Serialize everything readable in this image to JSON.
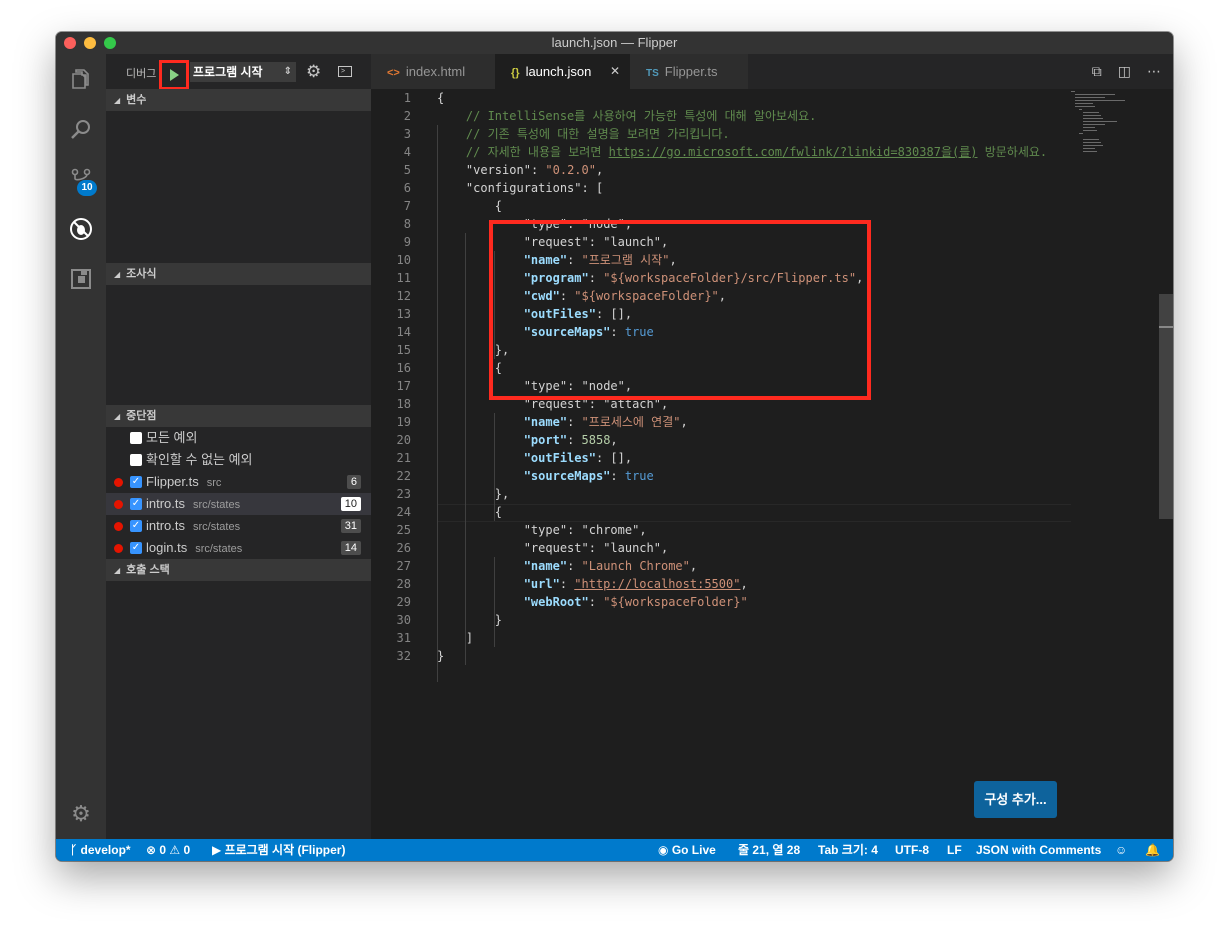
{
  "window": {
    "title": "launch.json — Flipper"
  },
  "activitybar": {
    "scm_badge": "10"
  },
  "debug": {
    "title": "디버그",
    "config_selected": "프로그램 시작",
    "select_arrows": "⇕"
  },
  "sections": {
    "variables": "변수",
    "watch": "조사식",
    "breakpoints": "중단점",
    "callstack": "호출 스택"
  },
  "breakpoints": {
    "all_exceptions": "모든 예외",
    "uncaught_exceptions": "확인할 수 없는 예외",
    "items": [
      {
        "file": "Flipper.ts",
        "path": "src",
        "line": "6"
      },
      {
        "file": "intro.ts",
        "path": "src/states",
        "line": "10"
      },
      {
        "file": "intro.ts",
        "path": "src/states",
        "line": "31"
      },
      {
        "file": "login.ts",
        "path": "src/states",
        "line": "14"
      }
    ]
  },
  "tabs": [
    {
      "icon": "<>",
      "label": "index.html"
    },
    {
      "icon": "{}",
      "label": "launch.json"
    },
    {
      "icon": "TS",
      "label": "Flipper.ts"
    }
  ],
  "tab_colors": {
    "html_icon": "#e37933",
    "json_icon": "#cbcb41",
    "ts_icon": "#519aba"
  },
  "code": {
    "line_numbers": [
      "1",
      "2",
      "3",
      "4",
      "5",
      "6",
      "7",
      "8",
      "9",
      "10",
      "11",
      "12",
      "13",
      "14",
      "15",
      "16",
      "17",
      "18",
      "19",
      "20",
      "21",
      "22",
      "23",
      "24",
      "25",
      "26",
      "27",
      "28",
      "29",
      "30",
      "31",
      "32"
    ],
    "comment1": "// IntelliSense를 사용하여 가능한 특성에 대해 알아보세요.",
    "comment2": "// 기존 특성에 대한 설명을 보려면 가리킵니다.",
    "comment3_pre": "// 자세한 내용을 보려면 ",
    "comment3_link": "https://go.microsoft.com/fwlink/?linkid=830387을(를)",
    "comment3_post": " 방문하세요.",
    "version_key": "\"version\"",
    "version_val": "\"0.2.0\"",
    "configs_key": "\"configurations\"",
    "c1_type": "\"node\"",
    "c1_request": "\"launch\"",
    "c1_name": "\"프로그램 시작\"",
    "c1_program": "\"${workspaceFolder}/src/Flipper.ts\"",
    "c1_cwd": "\"${workspaceFolder}\"",
    "c2_type": "\"node\"",
    "c2_request": "\"attach\"",
    "c2_name": "\"프로세스에 연결\"",
    "c2_port": "5858",
    "c3_type": "\"chrome\"",
    "c3_request": "\"launch\"",
    "c3_name": "\"Launch Chrome\"",
    "c3_url": "\"http://localhost:5500\"",
    "c3_webroot": "\"${workspaceFolder}\""
  },
  "add_config_button": "구성 추가...",
  "statusbar": {
    "branch": "develop*",
    "errors": "0",
    "warnings": "0",
    "debug_config": "프로그램 시작 (Flipper)",
    "golive": "Go Live",
    "position": "줄 21, 열 28",
    "tabsize": "Tab 크기: 4",
    "encoding": "UTF-8",
    "eol": "LF",
    "language": "JSON with Comments"
  }
}
